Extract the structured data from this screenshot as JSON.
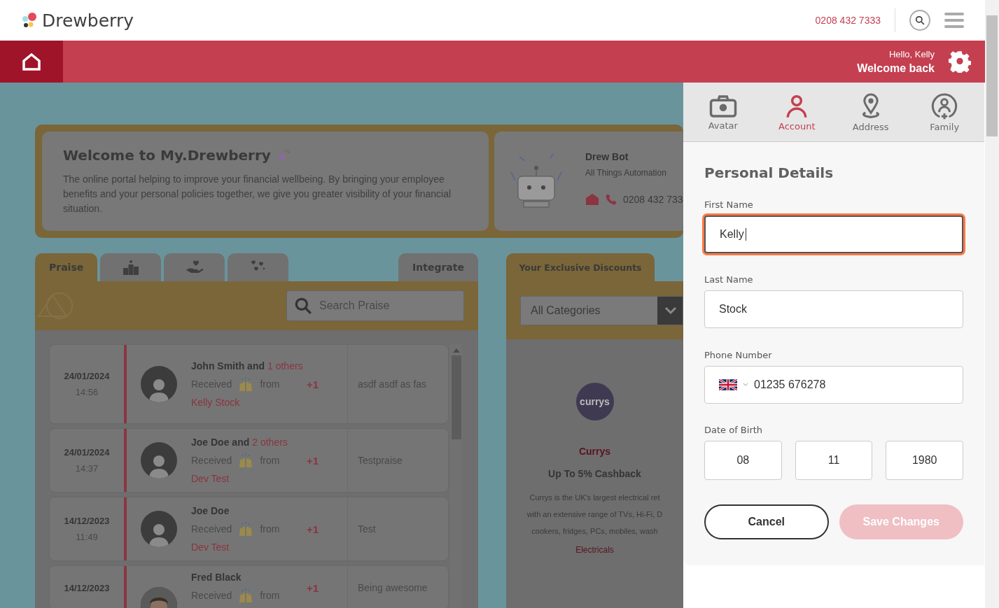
{
  "header": {
    "logo": "Drewberry",
    "phone": "0208 432 7333"
  },
  "banner": {
    "greeting": "Hello, Kelly",
    "welcome": "Welcome back"
  },
  "welcome_card": {
    "title": "Welcome to My.Drewberry",
    "text": "The online portal helping to improve your financial wellbeing. By bringing your employee benefits and your personal policies together, we give you greater visibility of your financial situation."
  },
  "bot_card": {
    "name": "Drew Bot",
    "subtitle": "All Things Automation",
    "phone": "0208 432 733"
  },
  "praise_panel": {
    "tabs": [
      {
        "label": "Praise",
        "selected": true
      },
      {
        "selected": false
      },
      {
        "selected": false
      },
      {
        "selected": false
      }
    ],
    "integrate": "Integrate",
    "search": {
      "placeholder": "Search Praise"
    },
    "items": [
      {
        "date": "24/01/2024",
        "time": "14:56",
        "names": "John Smith and",
        "others": "1 others",
        "received": "Received",
        "from": "from",
        "sender": "Kelly Stock",
        "points": "+1",
        "message": "asdf asdf as fas",
        "kind": "default"
      },
      {
        "date": "24/01/2024",
        "time": "14:37",
        "names": "Joe Doe and",
        "others": "2 others",
        "received": "Received",
        "from": "from",
        "sender": "Dev Test",
        "points": "+1",
        "message": "Testpraise",
        "kind": "default"
      },
      {
        "date": "14/12/2023",
        "time": "11:49",
        "names": "Joe Doe",
        "received": "Received",
        "from": "from",
        "sender": "Dev Test",
        "points": "+1",
        "message": "Test",
        "kind": "default"
      },
      {
        "date": "14/12/2023",
        "names": "Fred Black",
        "received": "Received",
        "from": "from",
        "points": "+1",
        "message": "Being awesome"
      }
    ]
  },
  "discounts_panel": {
    "title": "Your Exclusive Discounts",
    "category": "All Categories",
    "offer": {
      "logo": "currys",
      "name": "Currys",
      "headline": "Up To 5% Cashback",
      "description": [
        "Currys is the UK's largest electrical ret",
        "with an extensive range of TVs, Hi-Fi, D",
        "cookers, fridges, PCs, mobiles, wash"
      ],
      "category": "Electricals"
    }
  },
  "drawer": {
    "tabs": [
      {
        "label": "Avatar",
        "selected": false
      },
      {
        "label": "Account",
        "selected": true
      },
      {
        "label": "Address",
        "selected": false
      },
      {
        "label": "Family",
        "selected": false
      }
    ],
    "heading": "Personal Details",
    "first_name": {
      "label": "First Name",
      "value": "Kelly",
      "focused": true
    },
    "last_name": {
      "label": "Last Name",
      "value": "Stock",
      "focused": false
    },
    "phone": {
      "label": "Phone Number",
      "value": "01235 676278"
    },
    "dob": {
      "label": "Date of Birth",
      "parts": [
        "08",
        "11",
        "1980"
      ]
    },
    "cancel": "Cancel",
    "save": {
      "label": "Save Changes",
      "disabled": true
    }
  }
}
